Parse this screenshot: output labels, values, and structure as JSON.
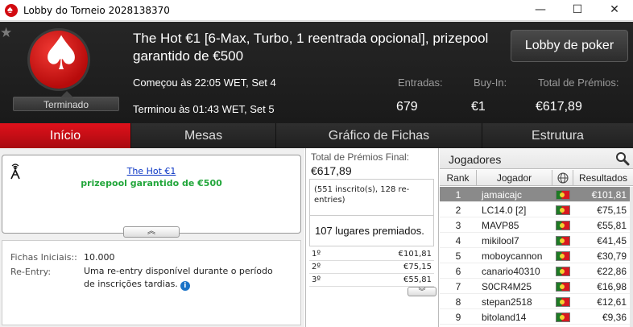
{
  "window": {
    "title": "Lobby do Torneio 2028138370",
    "minimize": "—",
    "maximize": "☐",
    "close": "✕"
  },
  "header": {
    "status": "Terminado",
    "tournament_name": "The Hot €1 [6-Max, Turbo, 1 reentrada opcional], prizepool garantido de €500",
    "started": "Começou às 22:05 WET, Set 4",
    "ended": "Terminou às 01:43 WET, Set 5",
    "entries_label": "Entradas:",
    "entries_value": "679",
    "buyin_label": "Buy-In:",
    "buyin_value": "€1",
    "total_prizes_label": "Total de Prémios:",
    "total_prizes_value": "€617,89",
    "lobby_button": "Lobby de poker"
  },
  "tabs": [
    {
      "label": "Início",
      "active": true
    },
    {
      "label": "Mesas",
      "active": false
    },
    {
      "label": "Gráfico de Fichas",
      "active": false
    },
    {
      "label": "Estrutura",
      "active": false
    }
  ],
  "info": {
    "title": "The Hot €1",
    "subtitle": "prizepool garantido de €500",
    "starting_chips_label": "Fichas Iniciais::",
    "starting_chips_value": "10.000",
    "reentry_label": "Re-Entry:",
    "reentry_value": "Uma re-entry disponível durante o período de inscrições tardias."
  },
  "prizepool": {
    "label": "Total de Prémios Final:",
    "value": "€617,89",
    "entries_note": "(551 inscrito(s), 128 re-entries)",
    "places": "107 lugares premiados.",
    "payouts": [
      {
        "place": "1º",
        "amount": "€101,81"
      },
      {
        "place": "2º",
        "amount": "€75,15"
      },
      {
        "place": "3º",
        "amount": "€55,81"
      }
    ]
  },
  "players": {
    "title": "Jogadores",
    "col_rank": "Rank",
    "col_player": "Jogador",
    "col_results": "Resultados",
    "rows": [
      {
        "rank": "1",
        "name": "jamaicajc",
        "result": "€101,81",
        "selected": true
      },
      {
        "rank": "2",
        "name": "LC14.0 [2]",
        "result": "€75,15"
      },
      {
        "rank": "3",
        "name": "MAVP85",
        "result": "€55,81"
      },
      {
        "rank": "4",
        "name": "mikilool7",
        "result": "€41,45"
      },
      {
        "rank": "5",
        "name": "moboycannon",
        "result": "€30,79"
      },
      {
        "rank": "6",
        "name": "canario40310",
        "result": "€22,86"
      },
      {
        "rank": "7",
        "name": "S0CR4M25",
        "result": "€16,98"
      },
      {
        "rank": "8",
        "name": "stepan2518",
        "result": "€12,61"
      },
      {
        "rank": "9",
        "name": "bitoland14",
        "result": "€9,36"
      }
    ]
  },
  "colors": {
    "accent_red": "#d20a10",
    "header_bg": "#1f1f1f",
    "link_blue": "#0b36c4",
    "guarantee_green": "#22a63b",
    "selected_row": "#8a8a8a"
  }
}
